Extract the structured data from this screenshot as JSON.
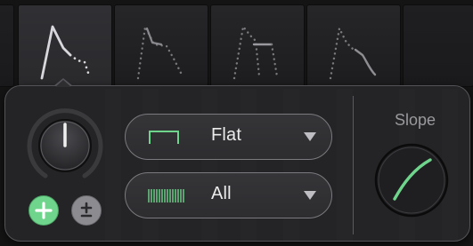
{
  "envelope_shapes": {
    "selected_index": 0,
    "tabs": [
      {
        "icon": "envelope-shape-icon",
        "selected": true
      },
      {
        "icon": "envelope-shape-icon",
        "selected": false
      },
      {
        "icon": "envelope-shape-icon",
        "selected": false
      },
      {
        "icon": "envelope-shape-icon",
        "selected": false
      }
    ]
  },
  "panel": {
    "amount_knob": {
      "icon": "knob-icon"
    },
    "add_button": {
      "label": "+",
      "icon": "plus-icon",
      "color": "#6fd58c"
    },
    "bipolar_button": {
      "label": "±",
      "icon": "plus-minus-icon",
      "color": "#8c8c90"
    },
    "filter_dropdown": {
      "value": "Flat",
      "icon": "flat-shape-icon"
    },
    "range_dropdown": {
      "value": "All",
      "icon": "keyboard-range-icon"
    },
    "slope": {
      "label": "Slope",
      "icon": "slope-curve-icon",
      "accent": "#6fd58c"
    }
  }
}
